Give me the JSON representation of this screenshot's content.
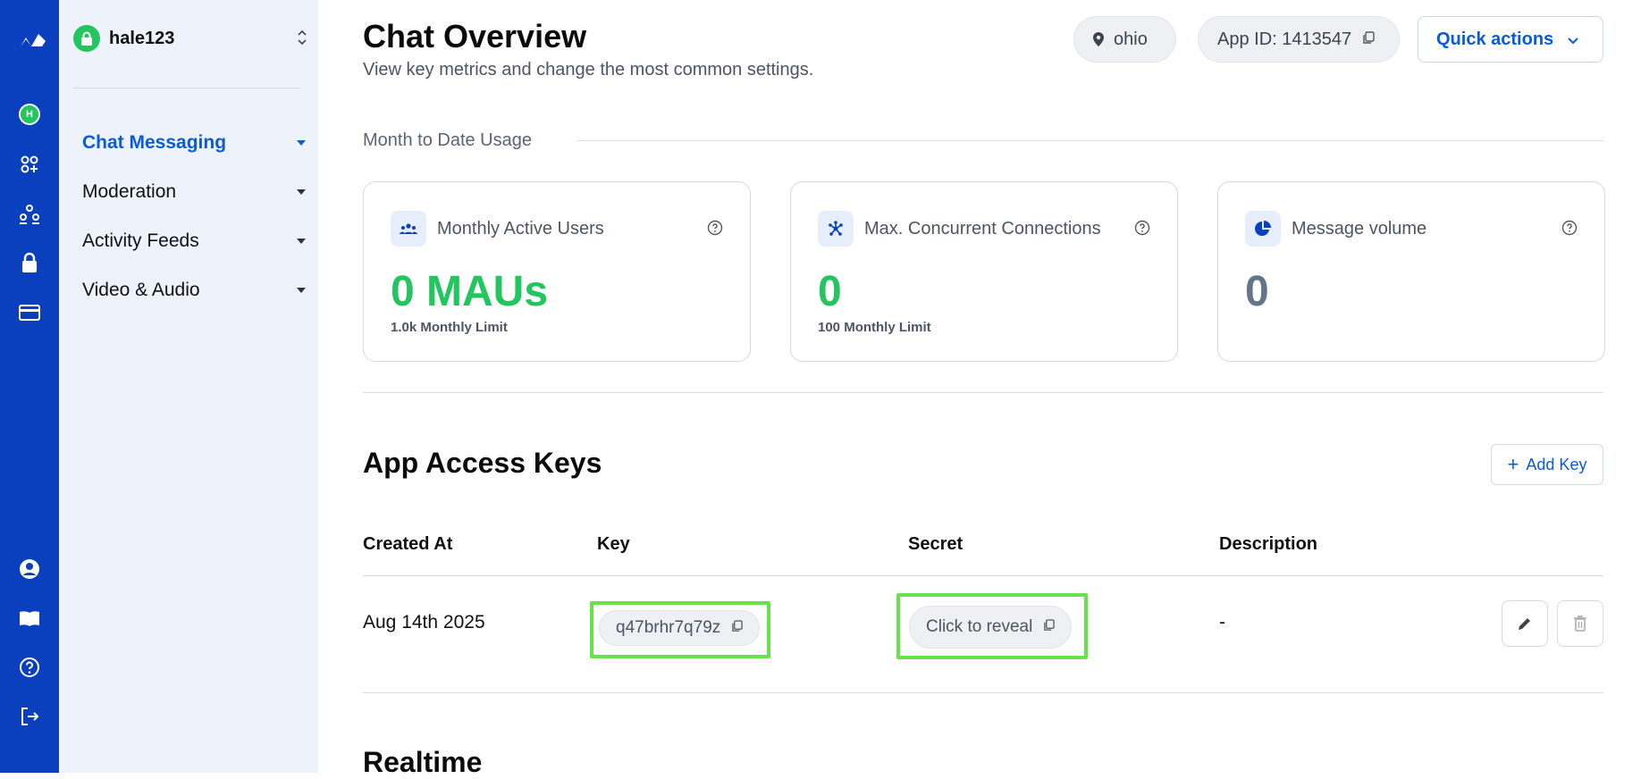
{
  "colors": {
    "rail": "#0a3fbd",
    "accent": "#0a5bd8",
    "green": "#22c55e",
    "highlight": "#66e34a"
  },
  "org": {
    "name": "hale123",
    "avatar_letter": "H"
  },
  "sidebar": {
    "items": [
      {
        "label": "Chat Messaging",
        "active": true
      },
      {
        "label": "Moderation",
        "active": false
      },
      {
        "label": "Activity Feeds",
        "active": false
      },
      {
        "label": "Video & Audio",
        "active": false
      }
    ]
  },
  "header": {
    "title": "Chat Overview",
    "subtitle": "View key metrics and change the most common settings.",
    "region": "ohio",
    "app_id": "App ID: 1413547",
    "quick_actions": "Quick actions"
  },
  "usage": {
    "section_label": "Month to Date Usage",
    "cards": [
      {
        "label": "Monthly Active Users",
        "value": "0 MAUs",
        "limit": "1.0k Monthly Limit",
        "icon": "users-icon"
      },
      {
        "label": "Max. Concurrent Connections",
        "value": "0",
        "limit": "100 Monthly Limit",
        "icon": "connections-icon"
      },
      {
        "label": "Message volume",
        "value": "0",
        "limit": "",
        "icon": "pie-chart-icon"
      }
    ]
  },
  "keys": {
    "title": "App Access Keys",
    "add_label": "Add Key",
    "columns": [
      "Created At",
      "Key",
      "Secret",
      "Description"
    ],
    "rows": [
      {
        "created_at": "Aug 14th 2025",
        "key": "q47brhr7q79z",
        "secret": "Click to reveal",
        "description": "-"
      }
    ]
  },
  "realtime": {
    "title": "Realtime"
  }
}
